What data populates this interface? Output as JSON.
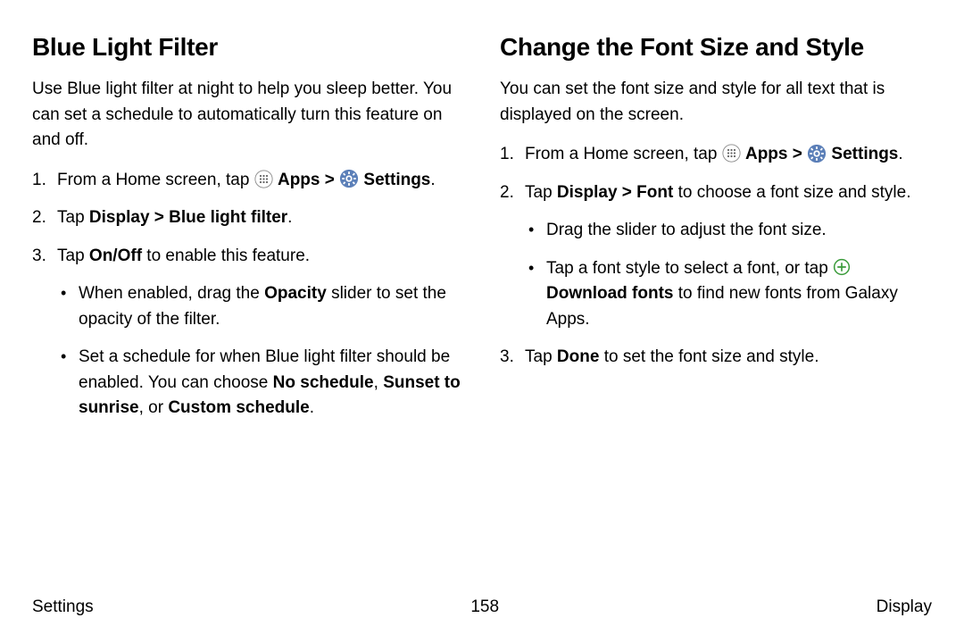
{
  "left": {
    "heading": "Blue Light Filter",
    "intro": "Use Blue light filter at night to help you sleep better. You can set a schedule to automatically turn this feature on and off.",
    "step1_pre": "From a Home screen, tap ",
    "apps_label": "Apps",
    "sep": " > ",
    "settings_label": "Settings",
    "step2_pre": "Tap ",
    "step2_bold": "Display > Blue light filter",
    "step3_pre": "Tap ",
    "step3_bold": "On/Off",
    "step3_post": " to enable this feature.",
    "bullet1_pre": "When enabled, drag the ",
    "bullet1_bold": "Opacity",
    "bullet1_post": " slider to set the opacity of the filter.",
    "bullet2_pre": "Set a schedule for when Blue light filter should be enabled. You can choose ",
    "bullet2_b1": "No schedule",
    "bullet2_mid": ", ",
    "bullet2_b2": "Sunset to sunrise",
    "bullet2_mid2": ", or ",
    "bullet2_b3": "Custom schedule",
    "bullet2_end": "."
  },
  "right": {
    "heading": "Change the Font Size and Style",
    "intro": "You can set the font size and style for all text that is displayed on the screen.",
    "step1_pre": "From a Home screen, tap ",
    "apps_label": "Apps",
    "sep": " > ",
    "settings_label": "Settings",
    "step2_pre": "Tap ",
    "step2_bold": "Display > Font",
    "step2_post": " to choose a font size and style.",
    "bullet1": "Drag the slider to adjust the font size.",
    "bullet2_pre": "Tap a font style to select a font, or tap ",
    "bullet2_bold": "Download fonts",
    "bullet2_post": " to find new fonts from Galaxy Apps.",
    "step3_pre": "Tap ",
    "step3_bold": "Done",
    "step3_post": " to set the font size and style."
  },
  "footer": {
    "left": "Settings",
    "center": "158",
    "right": "Display"
  }
}
